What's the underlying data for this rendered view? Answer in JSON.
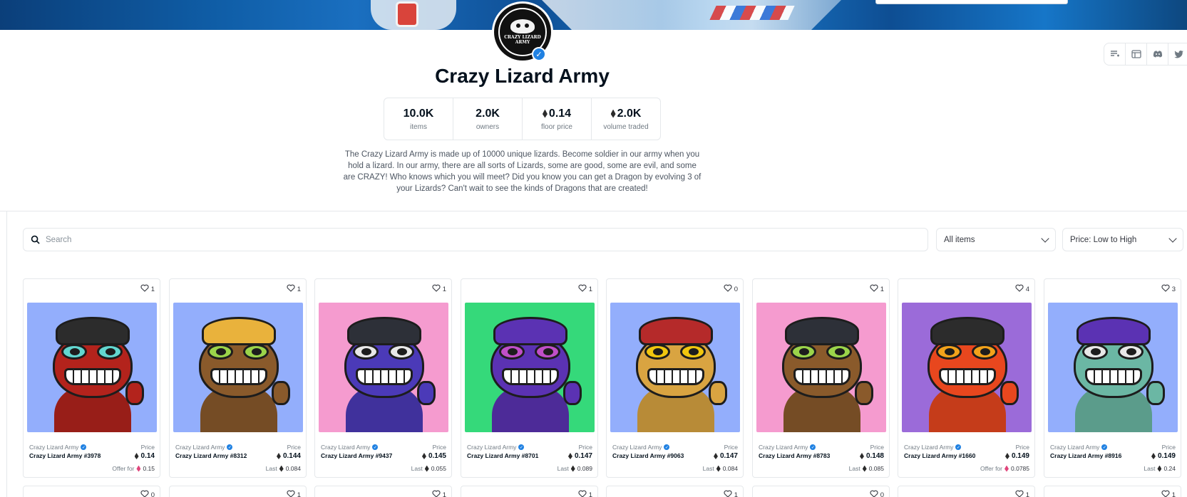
{
  "collection": {
    "title": "Crazy Lizard Army",
    "avatar_text": "CRAZY LIZARD ARMY",
    "description": "The Crazy Lizard Army is made up of 10000 unique lizards. Become soldier in our army when you hold a lizard. In our army, there are all sorts of Lizards, some are good, some are evil, and some are CRAZY! Who knows which you will meet? Did you know you can get a Dragon by evolving 3 of your Lizards? Can't wait to see the kinds of Dragons that are created!"
  },
  "stats": [
    {
      "value": "10.0K",
      "label": "items",
      "eth": false
    },
    {
      "value": "2.0K",
      "label": "owners",
      "eth": false
    },
    {
      "value": "0.14",
      "label": "floor price",
      "eth": true
    },
    {
      "value": "2.0K",
      "label": "volume traded",
      "eth": true
    }
  ],
  "social_icons": [
    "activity-icon",
    "website-icon",
    "discord-icon",
    "twitter-icon"
  ],
  "search": {
    "placeholder": "Search"
  },
  "filters": {
    "items": "All items",
    "sort": "Price: Low to High"
  },
  "card_labels": {
    "collection": "Crazy Lizard Army",
    "price": "Price"
  },
  "cards": [
    {
      "name": "Crazy Lizard Army #3978",
      "likes": "1",
      "price": "0.14",
      "sub_label": "Offer for",
      "sub_value": "0.15",
      "sub_pink": true,
      "bg": "#93aefc",
      "skin": "#b3231c",
      "hat": "#2c2c2c",
      "eye": "#62d7d0"
    },
    {
      "name": "Crazy Lizard Army #8312",
      "likes": "1",
      "price": "0.144",
      "sub_label": "Last",
      "sub_value": "0.084",
      "sub_pink": false,
      "bg": "#93aefc",
      "skin": "#8a5a2b",
      "hat": "#e9b23c",
      "eye": "#9bd44a"
    },
    {
      "name": "Crazy Lizard Army #9437",
      "likes": "1",
      "price": "0.145",
      "sub_label": "Last",
      "sub_value": "0.055",
      "sub_pink": false,
      "bg": "#f59bcf",
      "skin": "#4b3ab8",
      "hat": "#2d3038",
      "eye": "#e8e8e8"
    },
    {
      "name": "Crazy Lizard Army #8701",
      "likes": "1",
      "price": "0.147",
      "sub_label": "Last",
      "sub_value": "0.089",
      "sub_pink": false,
      "bg": "#35d97a",
      "skin": "#5b32b3",
      "hat": "#5b32b3",
      "eye": "#c04fc8"
    },
    {
      "name": "Crazy Lizard Army #9063",
      "likes": "0",
      "price": "0.147",
      "sub_label": "Last",
      "sub_value": "0.084",
      "sub_pink": false,
      "bg": "#93aefc",
      "skin": "#d9a441",
      "hat": "#b52a2a",
      "eye": "#f1c60e"
    },
    {
      "name": "Crazy Lizard Army #8783",
      "likes": "1",
      "price": "0.148",
      "sub_label": "Last",
      "sub_value": "0.085",
      "sub_pink": false,
      "bg": "#f59bcf",
      "skin": "#8a5a2b",
      "hat": "#2d3038",
      "eye": "#9bd44a"
    },
    {
      "name": "Crazy Lizard Army #1660",
      "likes": "4",
      "price": "0.149",
      "sub_label": "Offer for",
      "sub_value": "0.0785",
      "sub_pink": true,
      "bg": "#9b6bd9",
      "skin": "#e8471e",
      "hat": "#2c2c2c",
      "eye": "#f2a21a"
    },
    {
      "name": "Crazy Lizard Army #8916",
      "likes": "3",
      "price": "0.149",
      "sub_label": "Last",
      "sub_value": "0.24",
      "sub_pink": false,
      "bg": "#93aefc",
      "skin": "#6bb7a4",
      "hat": "#5b32b3",
      "eye": "#e8e8e8"
    }
  ],
  "row2_likes": [
    "0",
    "1",
    "1",
    "1",
    "1",
    "0",
    "1",
    "1"
  ]
}
